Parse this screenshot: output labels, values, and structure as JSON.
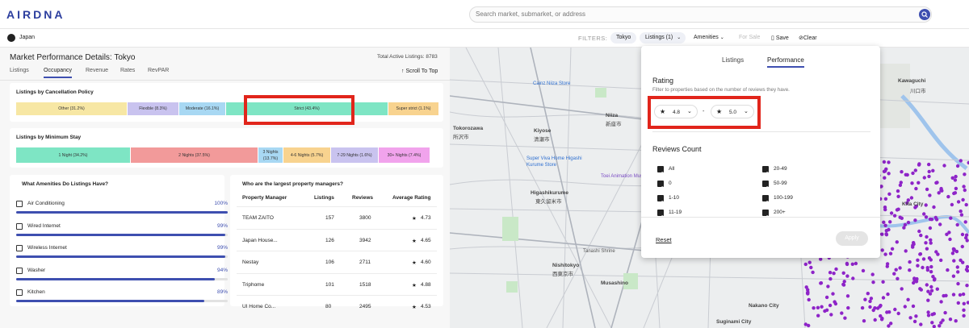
{
  "app": {
    "logo": "AIRDNA"
  },
  "search": {
    "placeholder": "Search market, submarket, or address"
  },
  "location": "Japan",
  "filters": {
    "label": "FILTERS:",
    "chips": [
      "Tokyo",
      "Listings (1)",
      "Amenities",
      "For Sale",
      "Save",
      "Clear"
    ]
  },
  "page": {
    "title_prefix": "Market Performance Details:",
    "title_market": "Tokyo",
    "total_label": "Total Active Listings: 8783",
    "tabs": [
      "Listings",
      "Occupancy",
      "Revenue",
      "Rates",
      "RevPAR"
    ],
    "active_tab": "Occupancy",
    "scroll_top": "Scroll To Top"
  },
  "cancellation": {
    "title": "Listings by Cancellation Policy",
    "segments": [
      {
        "label": "Other (31.2%)",
        "value": 31.2,
        "color": "#f7e7a4"
      },
      {
        "label": "Flexible (8.3%)",
        "value": 8.3,
        "color": "#c9c3ef"
      },
      {
        "label": "Moderate (16.1%)",
        "value": 16.1,
        "color": "#a8d8f3"
      },
      {
        "label": "Strict (43.4%)",
        "value": 43.4,
        "color": "#7ee5c4"
      },
      {
        "label": "Super strict (1.1%)",
        "value": 1.1,
        "color": "#f8d38f"
      }
    ]
  },
  "min_stay": {
    "title": "Listings by Minimum Stay",
    "segments": [
      {
        "label": "1 Night (34.2%)",
        "value": 34.2,
        "color": "#7ee5c4"
      },
      {
        "label": "2 Nights (37.5%)",
        "value": 37.5,
        "color": "#f29a9a"
      },
      {
        "label": "3 Nights (13.7%)",
        "value": 13.7,
        "color": "#a8d8f3"
      },
      {
        "label": "4-6 Nights (5.7%)",
        "value": 5.7,
        "color": "#f8d38f"
      },
      {
        "label": "7-29 Nights (1.6%)",
        "value": 1.6,
        "color": "#c9c3ef"
      },
      {
        "label": "30+ Nights (7.4%)",
        "value": 7.4,
        "color": "#f1a3ec"
      }
    ]
  },
  "amenities": {
    "title": "What Amenities Do Listings Have?",
    "items": [
      {
        "label": "Air Conditioning",
        "pct": "100%",
        "value": 100,
        "icon": "air-conditioning-icon"
      },
      {
        "label": "Wired Internet",
        "pct": "99%",
        "value": 99,
        "icon": "wired-internet-icon"
      },
      {
        "label": "Wireless Internet",
        "pct": "99%",
        "value": 99,
        "icon": "wifi-icon"
      },
      {
        "label": "Washer",
        "pct": "94%",
        "value": 94,
        "icon": "washer-icon"
      },
      {
        "label": "Kitchen",
        "pct": "89%",
        "value": 89,
        "icon": "kitchen-icon"
      }
    ]
  },
  "managers": {
    "title": "Who are the largest property managers?",
    "headers": [
      "Property Manager",
      "Listings",
      "Reviews",
      "Average Rating"
    ],
    "rows": [
      {
        "name": "TEAM ZAITO",
        "listings": "157",
        "reviews": "3800",
        "rating": "4.73"
      },
      {
        "name": "Japan House...",
        "listings": "126",
        "reviews": "3942",
        "rating": "4.65"
      },
      {
        "name": "Nestay",
        "listings": "106",
        "reviews": "2711",
        "rating": "4.60"
      },
      {
        "name": "Triphome",
        "listings": "101",
        "reviews": "1518",
        "rating": "4.88"
      },
      {
        "name": "UI Home Co...",
        "listings": "80",
        "reviews": "2495",
        "rating": "4.53"
      }
    ]
  },
  "filter_panel": {
    "tabs": [
      "Listings",
      "Performance"
    ],
    "active_tab": "Performance",
    "rating_title": "Rating",
    "rating_desc": "Filter to properties based on the number of reviews they have.",
    "rating_min": "4.8",
    "rating_max": "5.0",
    "range_sep": "-",
    "reviews_title": "Reviews Count",
    "reviews_options": [
      {
        "label": "All",
        "checked": true
      },
      {
        "label": "0",
        "checked": true
      },
      {
        "label": "1-10",
        "checked": true
      },
      {
        "label": "11-19",
        "checked": true
      },
      {
        "label": "20-49",
        "checked": true
      },
      {
        "label": "50-99",
        "checked": true
      },
      {
        "label": "100-199",
        "checked": true
      },
      {
        "label": "200+",
        "checked": true
      }
    ],
    "reset": "Reset",
    "apply": "Apply"
  },
  "map": {
    "labels": [
      "Kawaguchi",
      "川口市",
      "Niiza",
      "新座市",
      "Tokorozawa",
      "所沢市",
      "Kiyose",
      "清瀬市",
      "Higashikurume",
      "東久留米市",
      "Nishitokyo",
      "西東京市",
      "Musashino",
      "Nakano City",
      "Suginami City",
      "Kita City",
      "Tanashi Shrine"
    ],
    "pois": [
      "Cainz Niiza Store",
      "Super Viva Home Higashi Kurume Store",
      "Toei Animation Museum"
    ]
  }
}
